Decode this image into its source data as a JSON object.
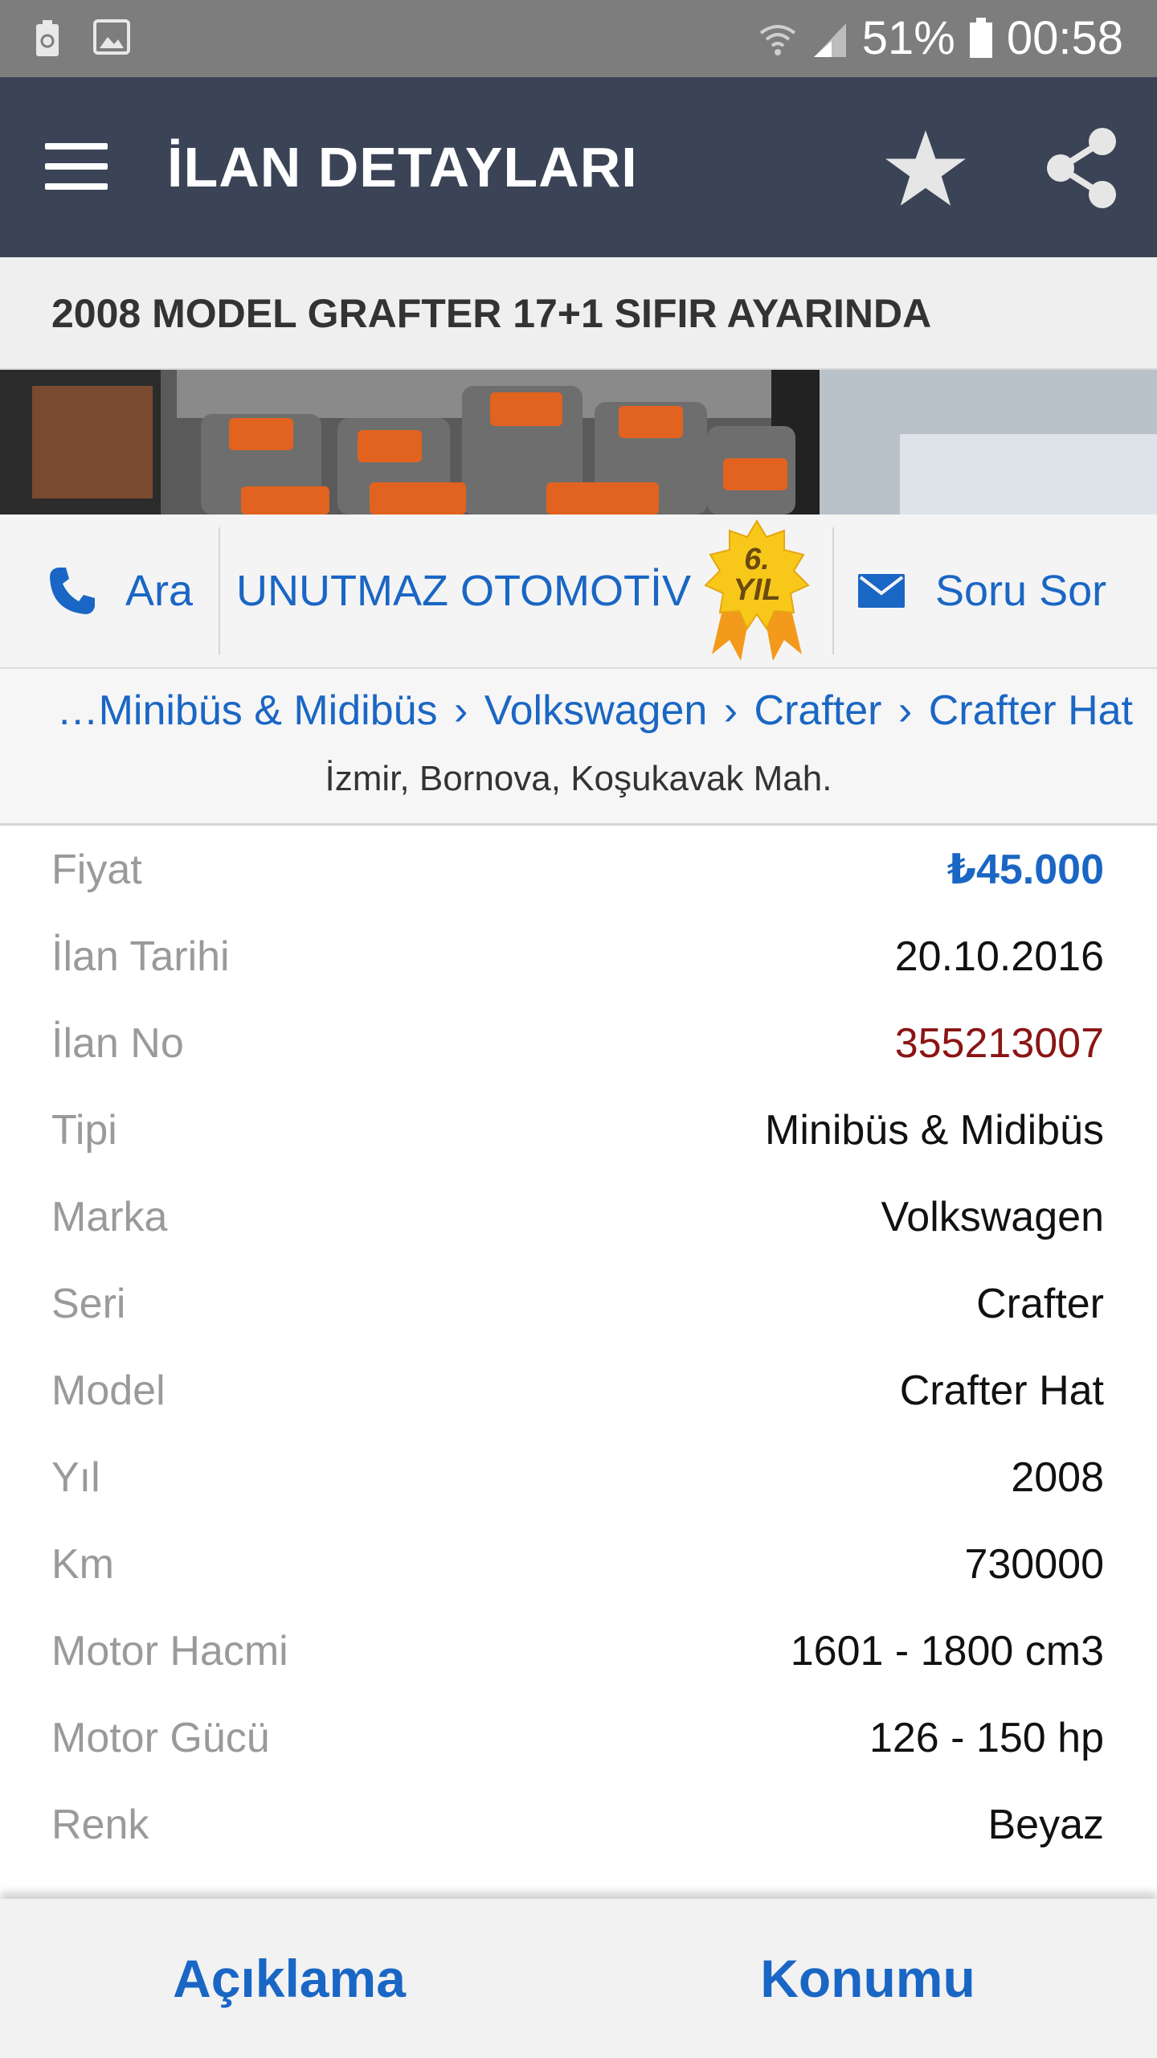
{
  "status_bar": {
    "battery_percent": "51%",
    "time": "00:58",
    "icons": [
      "battery-saver-icon",
      "image-icon",
      "wifi-icon",
      "signal-icon",
      "battery-icon"
    ]
  },
  "app_bar": {
    "title": "İLAN DETAYLARI",
    "icons": [
      "menu-icon",
      "star-icon",
      "share-icon"
    ]
  },
  "listing": {
    "title": "2008 MODEL GRAFTER 17+1 SIFIR AYARINDA"
  },
  "actions": {
    "call_label": "Ara",
    "dealer_name": "UNUTMAZ OTOMOTİV",
    "badge_line1": "6.",
    "badge_line2": "YIL",
    "ask_label": "Soru Sor"
  },
  "breadcrumb": {
    "items": [
      "…Minibüs & Midibüs",
      "Volkswagen",
      "Crafter",
      "Crafter Hat"
    ],
    "separator": "›"
  },
  "location": "İzmir, Bornova, Koşukavak Mah.",
  "details": [
    {
      "label": "Fiyat",
      "value": "₺45.000"
    },
    {
      "label": "İlan Tarihi",
      "value": "20.10.2016"
    },
    {
      "label": "İlan No",
      "value": "355213007"
    },
    {
      "label": "Tipi",
      "value": "Minibüs & Midibüs"
    },
    {
      "label": "Marka",
      "value": "Volkswagen"
    },
    {
      "label": "Seri",
      "value": "Crafter"
    },
    {
      "label": "Model",
      "value": "Crafter Hat"
    },
    {
      "label": "Yıl",
      "value": "2008"
    },
    {
      "label": "Km",
      "value": "730000"
    },
    {
      "label": "Motor Hacmi",
      "value": "1601 - 1800 cm3"
    },
    {
      "label": "Motor Gücü",
      "value": "126 - 150 hp"
    },
    {
      "label": "Renk",
      "value": "Beyaz"
    }
  ],
  "bottom_tabs": {
    "description": "Açıklama",
    "location": "Konumu"
  },
  "colors": {
    "status_bar": "#7d7d7d",
    "app_bar": "#3b4357",
    "link_blue": "#1a66c4",
    "listing_no_red": "#8b1414",
    "label_gray": "#9a9a9a"
  }
}
